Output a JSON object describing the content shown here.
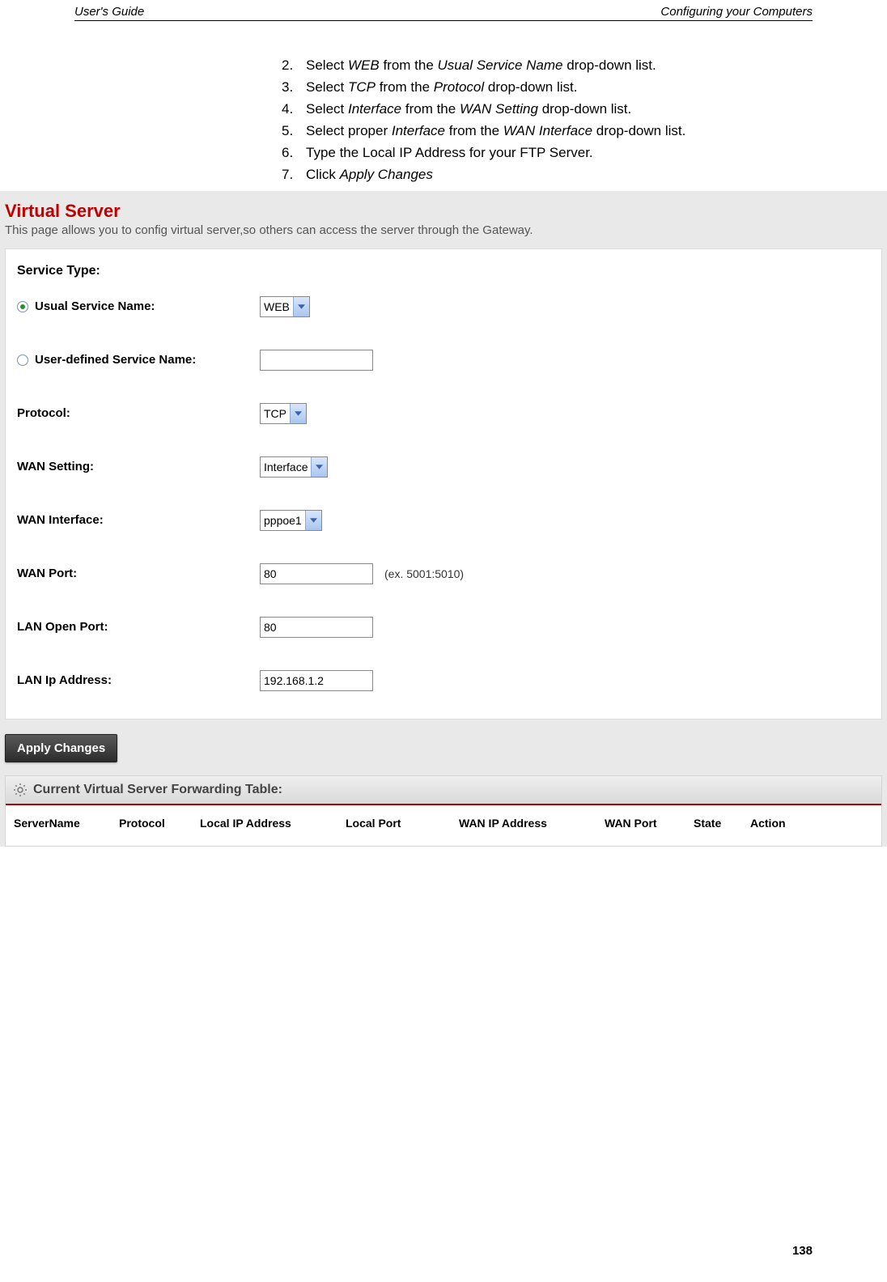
{
  "header": {
    "left": "User's Guide",
    "right": "Configuring your Computers"
  },
  "instructions": [
    {
      "n": "2.",
      "html": "Select <em>WEB</em> from the <em>Usual Service Name</em> drop-down list."
    },
    {
      "n": "3.",
      "html": "Select <em>TCP</em> from the <em>Protocol</em> drop-down list."
    },
    {
      "n": "4.",
      "html": "Select <em>Interface</em> from the <em>WAN Setting</em> drop-down list."
    },
    {
      "n": "5.",
      "html": "Select proper <em>Interface</em> from the <em>WAN Interface</em> drop-down list."
    },
    {
      "n": "6.",
      "html": "Type the Local IP Address for your FTP Server."
    },
    {
      "n": "7.",
      "html": "Click <em>Apply Changes</em>"
    }
  ],
  "vs": {
    "title": "Virtual Server",
    "subtitle": "This page allows you to config virtual server,so others can access the server through the Gateway.",
    "service_type_label": "Service Type:",
    "usual_label": "Usual Service Name:",
    "usual_value": "WEB",
    "userdef_label": "User-defined Service Name:",
    "userdef_value": "",
    "protocol_label": "Protocol:",
    "protocol_value": "TCP",
    "wan_setting_label": "WAN Setting:",
    "wan_setting_value": "Interface",
    "wan_iface_label": "WAN Interface:",
    "wan_iface_value": "pppoe1",
    "wan_port_label": "WAN Port:",
    "wan_port_value": "80",
    "wan_port_hint": "(ex. 5001:5010)",
    "lan_open_label": "LAN Open Port:",
    "lan_open_value": "80",
    "lan_ip_label": "LAN Ip Address:",
    "lan_ip_value": "192.168.1.2",
    "apply_label": "Apply Changes",
    "table_title": "Current Virtual Server Forwarding Table:",
    "columns": [
      "ServerName",
      "Protocol",
      "Local IP Address",
      "Local Port",
      "WAN IP Address",
      "WAN Port",
      "State",
      "Action"
    ]
  },
  "page_number": "138"
}
